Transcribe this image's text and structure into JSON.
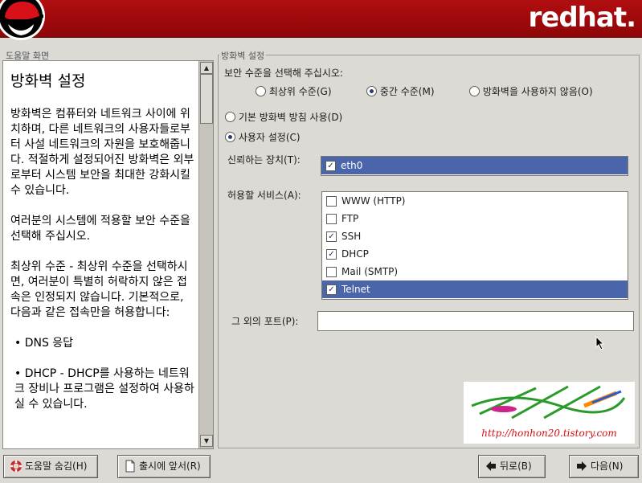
{
  "header": {
    "brand": "redhat."
  },
  "help": {
    "group_label": "도움말 화면",
    "title": "방화벽 설정",
    "paragraphs": [
      "방화벽은 컴퓨터와 네트워크 사이에 위치하며, 다른 네트워크의 사용자들로부터 사설 네트워크의 자원을 보호해줍니다. 적절하게 설정되어진 방화벽은 외부로부터 시스템 보안을 최대한 강화시킬 수 있습니다.",
      "여러분의 시스템에 적용할 보안 수준을 선택해 주십시오.",
      "최상위 수준 - 최상위 수준을 선택하시면, 여러분이 특별히 허락하지 않은 접속은 인정되지 않습니다. 기본적으로, 다음과 같은 접속만을 허용합니다:"
    ],
    "bullets": [
      "• DNS 응답",
      "• DHCP - DHCP를 사용하는 네트워크 장비나 프로그램은 설정하여 사용하실 수 있습니다."
    ]
  },
  "firewall": {
    "group_label": "방화벽 설정",
    "security_prompt": "보안 수준을 선택해 주십시오:",
    "levels": [
      {
        "label": "최상위 수준(G)",
        "selected": false
      },
      {
        "label": "중간 수준(M)",
        "selected": true
      },
      {
        "label": "방화벽을 사용하지 않음(O)",
        "selected": false
      }
    ],
    "rule_modes": [
      {
        "label": "기본 방화벽 방침 사용(D)",
        "selected": false
      },
      {
        "label": "사용자 설정(C)",
        "selected": true
      }
    ],
    "trusted_label": "신뢰하는 장치(T):",
    "trusted_devices": [
      {
        "label": "eth0",
        "checked": true,
        "selected": true
      }
    ],
    "services_label": "허용할 서비스(A):",
    "services": [
      {
        "label": "WWW (HTTP)",
        "checked": false,
        "selected": false
      },
      {
        "label": "FTP",
        "checked": false,
        "selected": false
      },
      {
        "label": "SSH",
        "checked": true,
        "selected": false
      },
      {
        "label": "DHCP",
        "checked": true,
        "selected": false
      },
      {
        "label": "Mail (SMTP)",
        "checked": false,
        "selected": false
      },
      {
        "label": "Telnet",
        "checked": true,
        "selected": true
      }
    ],
    "other_ports_label": "그 외의 포트(P):",
    "other_ports_value": ""
  },
  "watermark": {
    "url": "http://honhon20.tistory.com"
  },
  "buttons": {
    "hide_help": "도움말 숨김(H)",
    "release_notes": "출시에 앞서(R)",
    "back": "뒤로(B)",
    "next": "다음(N)"
  }
}
